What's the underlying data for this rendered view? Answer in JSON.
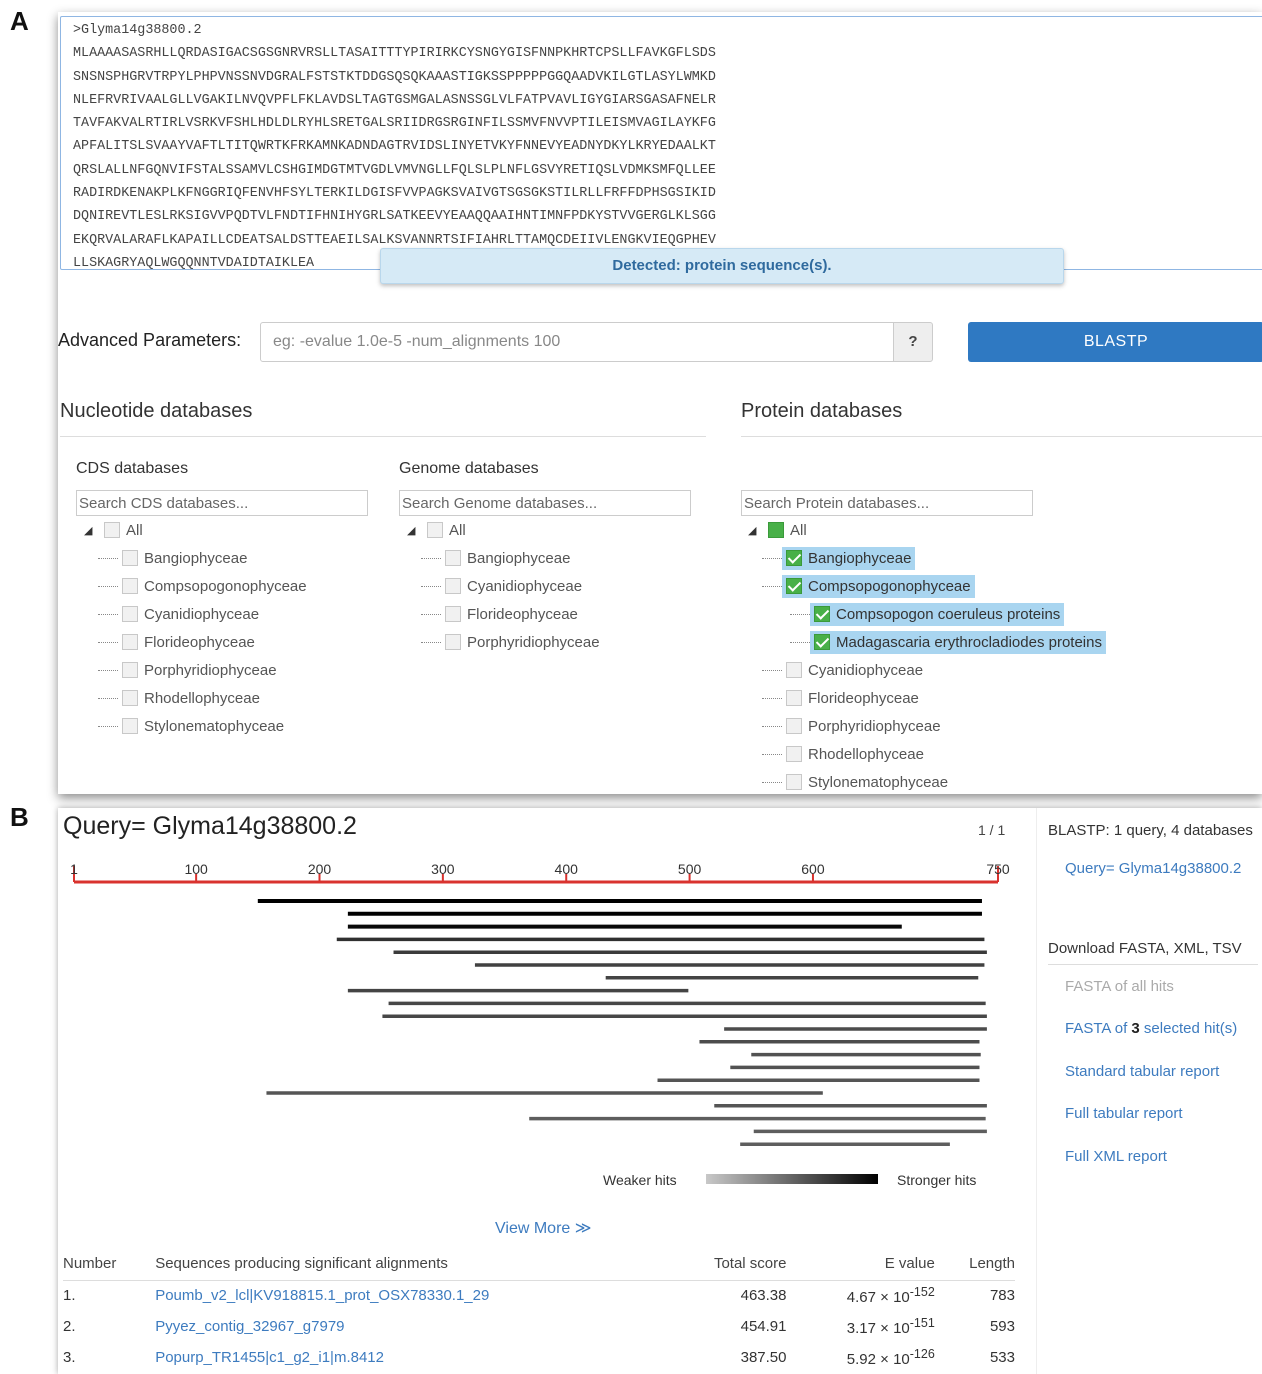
{
  "panel_labels": {
    "a": "A",
    "b": "B"
  },
  "sequence": {
    "lines": [
      ">Glyma14g38800.2",
      "MLAAAASASRHLLQRDASIGACSGSGNRVRSLLTASAITTTYPIRIRKCYSNGYGISFNNPKHRTCPSLLFAVKGFLSDS",
      "SNSNSPHGRVTRPYLPHPVNSSNVDGRALFSTSTKTDDGSQSQKAAASTIGKSSPPPPPGGQAADVKILGTLASYLWMKD",
      "NLEFRVRIVAALGLLVGAKILNVQVPFLFKLAVDSLTAGTGSMGALASNSSGLVLFATPVAVLIGYGIARSGASAFNELR",
      "TAVFAKVALRTIRLVSRKVFSHLHDLDLRYHLSRETGALSRIIDRGSRGINFILSSMVFNVVPTILEISMVAGILAYKFG",
      "APFALITSLSVAAYVAFTLTITQWRTKFRKAMNKADNDAGTRVIDSLINYETVKYFNNEVYEADNYDKYLKRYEDAALKT",
      "QRSLALLNFGQNVIFSTALSSAMVLCSHGIMDGTMTVGDLVMVNGLLFQLSLPLNFLGSVYRETIQSLVDMKSMFQLLEE",
      "RADIRDKENAKPLKFNGGRIQFENVHFSYLTERKILDGISFVVPAGKSVAIVGTSGSGKSTILRLLFRFFDPHSGSIKID",
      "DQNIREVTLESLRKSIGVVPQDTVLFNDTIFHNIHYGRLSATKEEVYEAAQQAAIHNTIMNFPDKYSTVVGERGLKLSGG",
      "EKQRVALARAFLKAPAILLCDEATSALDSTTEAEILSALKSVANNRTSIFIAHRLTTAMQCDEIIVLENGKVIEQGPHEV",
      "LLSKAGRYAQLWGQQNNTVDAIDTAIKLEA"
    ],
    "detected": "Detected: protein sequence(s)."
  },
  "advanced": {
    "label": "Advanced Parameters:",
    "placeholder": "eg: -evalue 1.0e-5 -num_alignments 100",
    "help": "?",
    "blast_button": "BLASTP"
  },
  "nucleotide": {
    "heading": "Nucleotide databases",
    "cds": {
      "heading": "CDS databases",
      "placeholder": "Search CDS databases...",
      "all": "All",
      "items": [
        "Bangiophyceae",
        "Compsopogonophyceae",
        "Cyanidiophyceae",
        "Florideophyceae",
        "Porphyridiophyceae",
        "Rhodellophyceae",
        "Stylonematophyceae"
      ]
    },
    "genome": {
      "heading": "Genome databases",
      "placeholder": "Search Genome databases...",
      "all": "All",
      "items": [
        "Bangiophyceae",
        "Cyanidiophyceae",
        "Florideophyceae",
        "Porphyridiophyceae"
      ]
    }
  },
  "protein": {
    "heading": "Protein databases",
    "placeholder": "Search Protein databases...",
    "all": "All",
    "items": [
      {
        "label": "Bangiophyceae",
        "checked": true
      },
      {
        "label": "Compsopogonophyceae",
        "checked": true
      },
      {
        "label": "Compsopogon coeruleus proteins",
        "checked": true
      },
      {
        "label": "Madagascaria erythrocladiodes proteins",
        "checked": true
      },
      {
        "label": "Cyanidiophyceae",
        "checked": false
      },
      {
        "label": "Florideophyceae",
        "checked": false
      },
      {
        "label": "Porphyridiophyceae",
        "checked": false
      },
      {
        "label": "Rhodellophyceae",
        "checked": false
      },
      {
        "label": "Stylonematophyceae",
        "checked": false
      }
    ]
  },
  "results": {
    "query_title": "Query= Glyma14g38800.2",
    "page": "1 / 1",
    "ruler_labels": [
      "1",
      "100",
      "200",
      "300",
      "400",
      "500",
      "600",
      "750"
    ],
    "query_length": 750,
    "hits": [
      {
        "start": 150,
        "end": 737,
        "strength": 1.0
      },
      {
        "start": 223,
        "end": 737,
        "strength": 1.0
      },
      {
        "start": 223,
        "end": 672,
        "strength": 0.95
      },
      {
        "start": 214,
        "end": 739,
        "strength": 0.72
      },
      {
        "start": 260,
        "end": 741,
        "strength": 0.65
      },
      {
        "start": 326,
        "end": 739,
        "strength": 0.62
      },
      {
        "start": 432,
        "end": 734,
        "strength": 0.6
      },
      {
        "start": 223,
        "end": 499,
        "strength": 0.6
      },
      {
        "start": 256,
        "end": 740,
        "strength": 0.58
      },
      {
        "start": 251,
        "end": 741,
        "strength": 0.58
      },
      {
        "start": 528,
        "end": 741,
        "strength": 0.55
      },
      {
        "start": 508,
        "end": 735,
        "strength": 0.55
      },
      {
        "start": 550,
        "end": 736,
        "strength": 0.52
      },
      {
        "start": 533,
        "end": 735,
        "strength": 0.52
      },
      {
        "start": 474,
        "end": 735,
        "strength": 0.5
      },
      {
        "start": 157,
        "end": 608,
        "strength": 0.5
      },
      {
        "start": 520,
        "end": 741,
        "strength": 0.5
      },
      {
        "start": 370,
        "end": 740,
        "strength": 0.45
      },
      {
        "start": 552,
        "end": 741,
        "strength": 0.45
      },
      {
        "start": 541,
        "end": 711,
        "strength": 0.45
      }
    ],
    "legend_weak": "Weaker hits",
    "legend_strong": "Stronger hits",
    "view_more": "View More ≫"
  },
  "table": {
    "headers": [
      "Number",
      "Sequences producing significant alignments",
      "Total score",
      "E value",
      "Length"
    ],
    "rows": [
      {
        "num": "1.",
        "name": "Poumb_v2_lcl|KV918815.1_prot_OSX78330.1_29",
        "score": "463.38",
        "e_base": "4.67 × 10",
        "e_exp": "-152",
        "length": "783"
      },
      {
        "num": "2.",
        "name": "Pyyez_contig_32967_g7979",
        "score": "454.91",
        "e_base": "3.17 × 10",
        "e_exp": "-151",
        "length": "593"
      },
      {
        "num": "3.",
        "name": "Popurp_TR1455|c1_g2_i1|m.8412",
        "score": "387.50",
        "e_base": "5.92 × 10",
        "e_exp": "-126",
        "length": "533"
      }
    ]
  },
  "sidebar": {
    "title": "BLASTP: 1 query, 4 databases",
    "query_link": "Query= Glyma14g38800.2",
    "download_heading": "Download FASTA, XML, TSV",
    "fasta_all": "FASTA of all hits",
    "fasta_sel_pre": "FASTA of ",
    "fasta_sel_num": "3",
    "fasta_sel_post": " selected hit(s)",
    "std_tab": "Standard tabular report",
    "full_tab": "Full tabular report",
    "full_xml": "Full XML report"
  }
}
